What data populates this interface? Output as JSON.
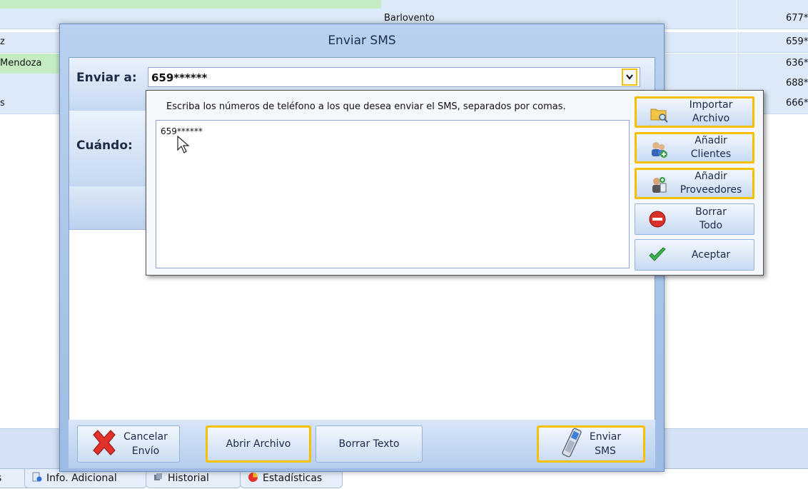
{
  "background_list": {
    "rows": [
      {
        "left": "",
        "middle": "",
        "right": "",
        "green": true
      },
      {
        "left": "",
        "middle": "Barlovento",
        "right": "677*",
        "green": false
      },
      {
        "left": "z",
        "middle": "",
        "right": "659*",
        "green": false
      },
      {
        "left": "Mendoza",
        "middle": "",
        "right": "636*",
        "green": true
      },
      {
        "left": "",
        "middle": "",
        "right": "688*",
        "green": false
      },
      {
        "left": "s",
        "middle": "",
        "right": "666*",
        "green": false
      }
    ]
  },
  "tabs": [
    {
      "label": "s",
      "icon": ""
    },
    {
      "label": "Info. Adicional",
      "icon": "info-icon"
    },
    {
      "label": "Historial",
      "icon": "history-icon"
    },
    {
      "label": "Estadísticas",
      "icon": "stats-icon"
    }
  ],
  "dialog": {
    "title": "Enviar SMS",
    "to_label": "Enviar a:",
    "to_value": "659******",
    "when_label": "Cuándo:",
    "footer": {
      "cancel_line1": "Cancelar",
      "cancel_line2": "Envío",
      "open_file": "Abrir Archivo",
      "clear_text": "Borrar Texto",
      "send_line1": "Enviar",
      "send_line2": "SMS"
    }
  },
  "popup": {
    "hint": "Escriba los números de teléfono a los que desea enviar el SMS, separados por comas.",
    "numbers_value": "659******",
    "buttons": [
      {
        "line1": "Importar",
        "line2": "Archivo",
        "icon": "folder-search-icon"
      },
      {
        "line1": "Añadir",
        "line2": "Clientes",
        "icon": "add-clients-icon"
      },
      {
        "line1": "Añadir",
        "line2": "Proveedores",
        "icon": "add-suppliers-icon"
      },
      {
        "line1": "Borrar",
        "line2": "Todo",
        "icon": "delete-all-icon"
      },
      {
        "line1": "Aceptar",
        "line2": "",
        "icon": "check-icon"
      }
    ]
  },
  "colors": {
    "highlight": "#f5c000",
    "dialog_bg": "#b9d1f0",
    "row_bg": "#dbe9f8",
    "row_green": "#c6ecc4"
  }
}
